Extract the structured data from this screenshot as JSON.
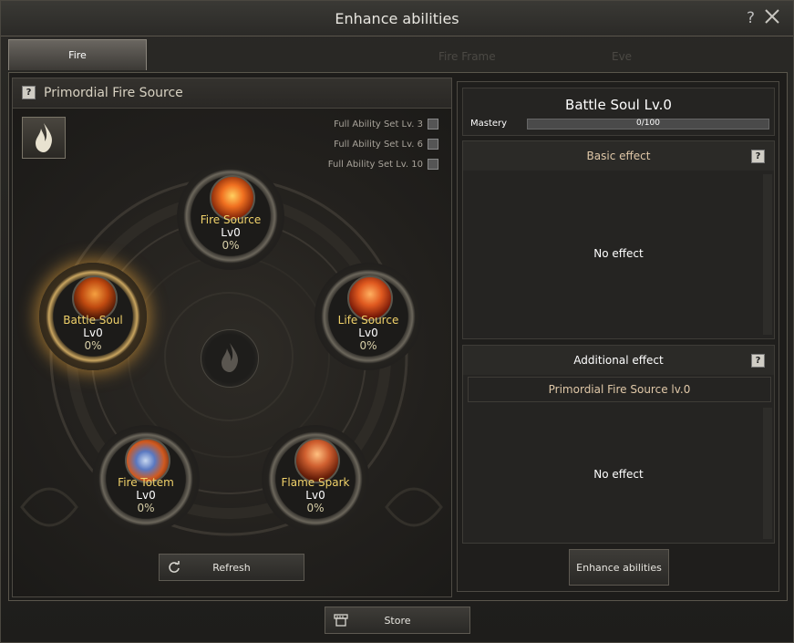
{
  "window": {
    "title": "Enhance abilities",
    "help_icon": "?"
  },
  "tabs": [
    {
      "label": "Fire"
    }
  ],
  "ghost": {
    "left": "Fire Frame",
    "right": "Eve"
  },
  "left_panel": {
    "title": "Primordial Fire Source",
    "help": "?",
    "sets": [
      {
        "label": "Full Ability Set Lv. 3"
      },
      {
        "label": "Full Ability Set Lv. 6"
      },
      {
        "label": "Full Ability Set Lv. 10"
      }
    ],
    "nodes": [
      {
        "name": "Fire Source",
        "level": "Lv0",
        "percent": "0%"
      },
      {
        "name": "Battle Soul",
        "level": "Lv0",
        "percent": "0%"
      },
      {
        "name": "Life Source",
        "level": "Lv0",
        "percent": "0%"
      },
      {
        "name": "Fire Totem",
        "level": "Lv0",
        "percent": "0%"
      },
      {
        "name": "Flame Spark",
        "level": "Lv0",
        "percent": "0%"
      }
    ],
    "refresh_label": "Refresh"
  },
  "right_panel": {
    "skill_title": "Battle Soul Lv.0",
    "mastery_label": "Mastery",
    "mastery_value": "0/100",
    "mastery_fraction": 0,
    "basic_header": "Basic effect",
    "basic_text": "No effect",
    "additional_header": "Additional effect",
    "additional_sub": "Primordial Fire Source lv.0",
    "additional_text": "No effect",
    "enhance_label": "Enhance abilities",
    "help": "?"
  },
  "footer": {
    "store_label": "Store"
  },
  "colors": {
    "accent_gold": "#f1d26a",
    "fire": "#e8642a"
  }
}
